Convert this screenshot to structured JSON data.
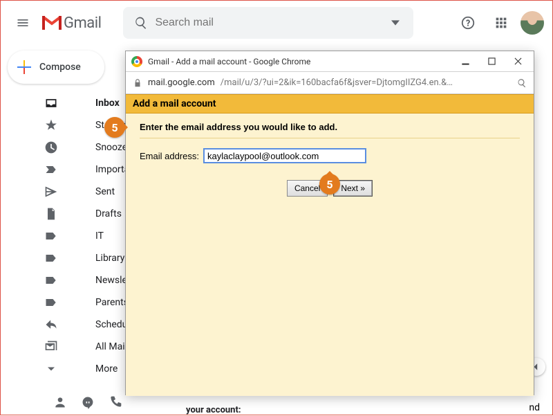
{
  "header": {
    "product": "Gmail",
    "search_placeholder": "Search mail"
  },
  "compose_label": "Compose",
  "sidebar": {
    "items": [
      {
        "label": "Inbox",
        "icon": "inbox-icon",
        "active": true
      },
      {
        "label": "Starred",
        "icon": "star-icon"
      },
      {
        "label": "Snoozed",
        "icon": "clock-icon"
      },
      {
        "label": "Important",
        "icon": "important-icon"
      },
      {
        "label": "Sent",
        "icon": "send-icon"
      },
      {
        "label": "Drafts",
        "icon": "file-icon"
      },
      {
        "label": "IT",
        "icon": "label-icon"
      },
      {
        "label": "Library",
        "icon": "label-icon"
      },
      {
        "label": "Newsletters",
        "icon": "label-icon"
      },
      {
        "label": "Parents",
        "icon": "label-icon"
      },
      {
        "label": "Scheduled",
        "icon": "schedule-icon"
      },
      {
        "label": "All Mail",
        "icon": "stacked-mail-icon"
      },
      {
        "label": "More",
        "icon": "chevron-down-icon"
      }
    ]
  },
  "dialog": {
    "window_title": "Gmail - Add a mail account - Google Chrome",
    "url_secure_host": "mail.google.com",
    "url_path": "/mail/u/3/?ui=2&ik=160bacfa6f&jsver=DjtomgIIZG4.en.&…",
    "heading": "Add a mail account",
    "instruction": "Enter the email address you would like to add.",
    "email_label": "Email address:",
    "email_value": "kaylaclaypool@outlook.com",
    "cancel_label": "Cancel",
    "next_label": "Next »"
  },
  "callout_number": "5",
  "background_text": {
    "nd_fragment": "nd",
    "your_account": "your account:"
  }
}
